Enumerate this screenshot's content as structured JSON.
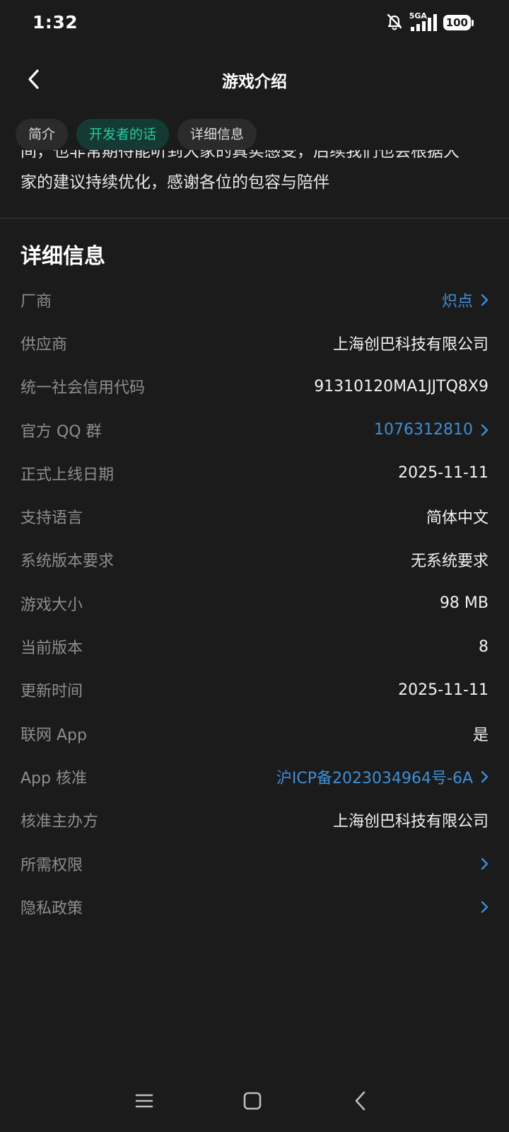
{
  "status_bar": {
    "time": "1:32",
    "network": "5GA",
    "battery": "100",
    "icons": [
      "bell-muted-icon",
      "signal-icon",
      "battery-icon"
    ]
  },
  "header": {
    "title": "游戏介绍",
    "back_icon": "chevron-left-icon"
  },
  "tabs": [
    {
      "label": "简介",
      "active": false
    },
    {
      "label": "开发者的话",
      "active": true
    },
    {
      "label": "详细信息",
      "active": false
    }
  ],
  "developer_words": {
    "clipped_line": "间，也非常期待能听到大家的真实感受，后续我们也会根据大",
    "last_line": "家的建议持续优化，感谢各位的包容与陪伴"
  },
  "details": {
    "title": "详细信息",
    "rows": [
      {
        "label": "厂商",
        "value": "炽点",
        "link": true
      },
      {
        "label": "供应商",
        "value": "上海创巴科技有限公司",
        "link": false
      },
      {
        "label": "统一社会信用代码",
        "value": "91310120MA1JJTQ8X9",
        "link": false
      },
      {
        "label": "官方 QQ 群",
        "value": "1076312810",
        "link": true
      },
      {
        "label": "正式上线日期",
        "value": "2025-11-11",
        "link": false
      },
      {
        "label": "支持语言",
        "value": "简体中文",
        "link": false
      },
      {
        "label": "系统版本要求",
        "value": "无系统要求",
        "link": false
      },
      {
        "label": "游戏大小",
        "value": "98 MB",
        "link": false
      },
      {
        "label": "当前版本",
        "value": "8",
        "link": false
      },
      {
        "label": "更新时间",
        "value": "2025-11-11",
        "link": false
      },
      {
        "label": "联网 App",
        "value": "是",
        "link": false
      },
      {
        "label": "App 核准",
        "value": "沪ICP备2023034964号-6A",
        "link": true
      },
      {
        "label": "核准主办方",
        "value": "上海创巴科技有限公司",
        "link": false
      },
      {
        "label": "所需权限",
        "value": "",
        "link": true
      },
      {
        "label": "隐私政策",
        "value": "",
        "link": true
      }
    ]
  },
  "nav_bar": {
    "icons": [
      "menu-icon",
      "home-icon",
      "back-icon"
    ]
  },
  "colors": {
    "background": "#1b1b1c",
    "accent": "#25c9a1",
    "link": "#3d8fd6",
    "label": "#8e8e90"
  }
}
